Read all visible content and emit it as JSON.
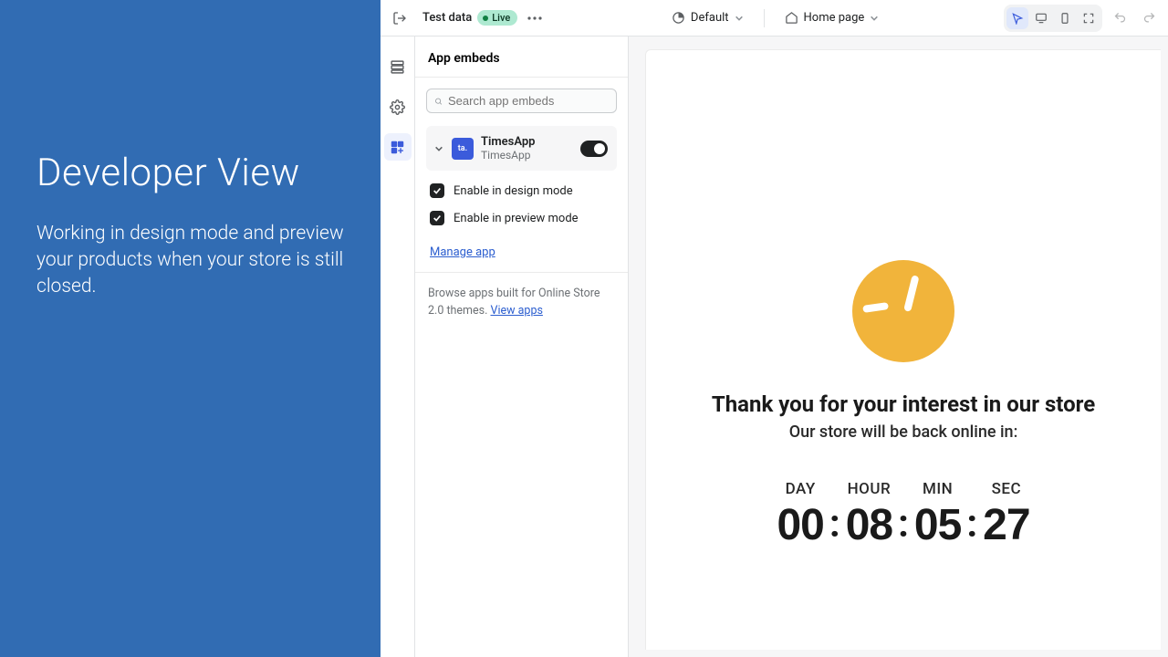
{
  "promo": {
    "heading": "Developer View",
    "subtext": "Working in design mode and preview your products when your store is still closed."
  },
  "topbar": {
    "test_data": "Test data",
    "live": "Live",
    "style_dropdown": "Default",
    "page_dropdown": "Home page"
  },
  "sidebar": {
    "title": "App embeds",
    "search_placeholder": "Search app embeds",
    "app": {
      "icon_text": "ta.",
      "name": "TimesApp",
      "subtitle": "TimesApp"
    },
    "enable_design": "Enable in design mode",
    "enable_preview": "Enable in preview mode",
    "manage_app": "Manage app",
    "browse_text": "Browse apps built for Online Store 2.0 themes. ",
    "view_apps": "View apps"
  },
  "preview": {
    "thank": "Thank you for your interest in our store",
    "back": "Our store will be back online in:",
    "labels": {
      "day": "DAY",
      "hour": "HOUR",
      "min": "MIN",
      "sec": "SEC"
    },
    "values": {
      "day": "00",
      "hour": "08",
      "min": "05",
      "sec": "27"
    }
  }
}
